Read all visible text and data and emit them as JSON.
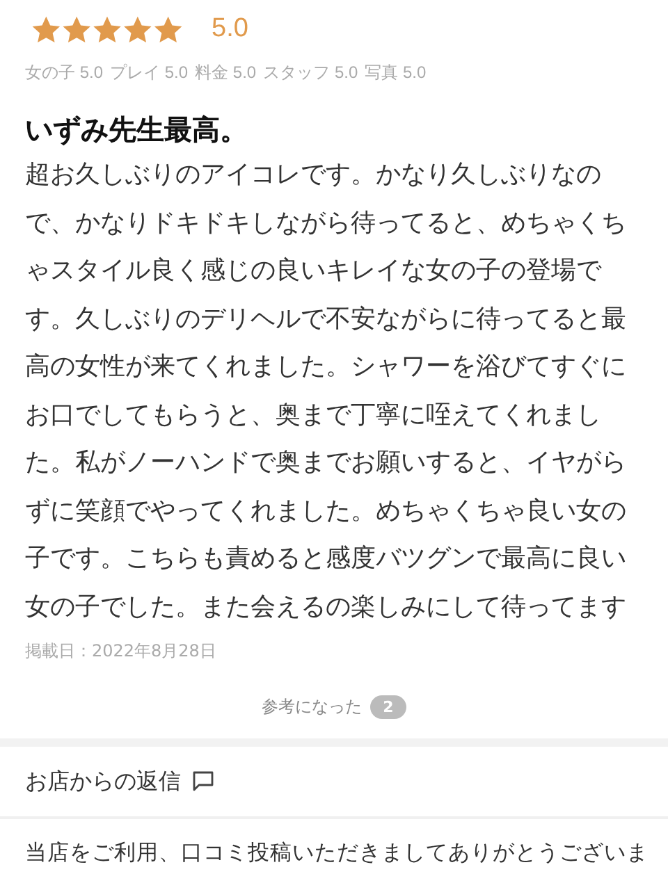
{
  "rating": {
    "stars": 5,
    "score": "5.0"
  },
  "subscores": [
    {
      "label": "女の子",
      "value": "5.0"
    },
    {
      "label": "プレイ",
      "value": "5.0"
    },
    {
      "label": "料金",
      "value": "5.0"
    },
    {
      "label": "スタッフ",
      "value": "5.0"
    },
    {
      "label": "写真",
      "value": "5.0"
    }
  ],
  "review": {
    "title": "いずみ先生最高。",
    "body_lines": [
      "超お久しぶりのアイコレです。かなり久しぶりなの",
      "で、かなりドキドキしながら待ってると、めちゃくち",
      "ゃスタイル良く感じの良いキレイな女の子の登場で",
      "す。久しぶりのデリヘルで不安ながらに待ってると最",
      "高の女性が来てくれました。シャワーを浴びてすぐに",
      "お口でしてもらうと、奥まで丁寧に咥えてくれまし",
      "た。私がノーハンドで奥までお願いすると、イヤがら",
      "ずに笑顔でやってくれました。めちゃくちゃ良い女の",
      "子です。こちらも責めると感度バツグンで最高に良い",
      "女の子でした。また会えるの楽しみにして待ってます"
    ],
    "posted": "掲載日：2022年8月28日"
  },
  "helpful": {
    "label": "参考になった",
    "count": "2"
  },
  "shop_reply": {
    "heading": "お店からの返信",
    "text": "当店をご利用、口コミ投稿いただきましてありがとうございま"
  }
}
